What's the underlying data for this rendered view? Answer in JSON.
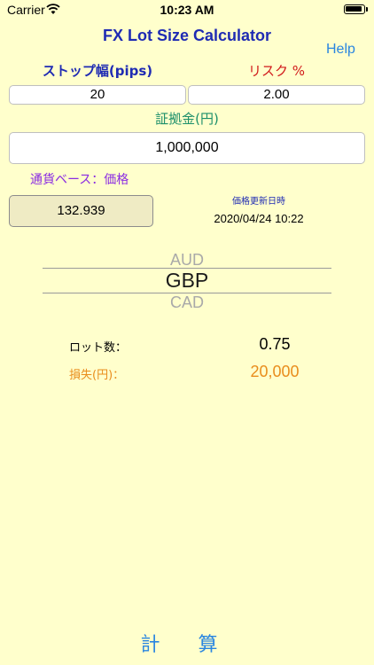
{
  "status_bar": {
    "carrier": "Carrier",
    "time": "10:23 AM"
  },
  "header": {
    "title": "FX Lot Size Calculator",
    "help_label": "Help"
  },
  "inputs": {
    "stop_label": "ストップ幅(pips)",
    "risk_label": "リスク %",
    "stop_value": "20",
    "risk_value": "2.00",
    "margin_label": "証拠金(円)",
    "margin_value": "1,000,000"
  },
  "price": {
    "base_label": "通貨ベース：価格",
    "value": "132.939",
    "updated_label": "価格更新日時",
    "updated_value": "2020/04/24 10:22"
  },
  "picker": {
    "above": "AUD",
    "selected": "GBP",
    "below": "CAD"
  },
  "results": {
    "lot_label": "ロット数：",
    "lot_value": "0.75",
    "loss_label": "損失(円)：",
    "loss_value": "20,000"
  },
  "actions": {
    "calculate_label": "計 算"
  },
  "colors": {
    "background": "#ffffcc",
    "title": "#1f2bb3",
    "link": "#2a86e0",
    "risk": "#d11a1a",
    "margin_label": "#1c8f6a",
    "base_label": "#8a2be2",
    "loss": "#e98d1c"
  }
}
